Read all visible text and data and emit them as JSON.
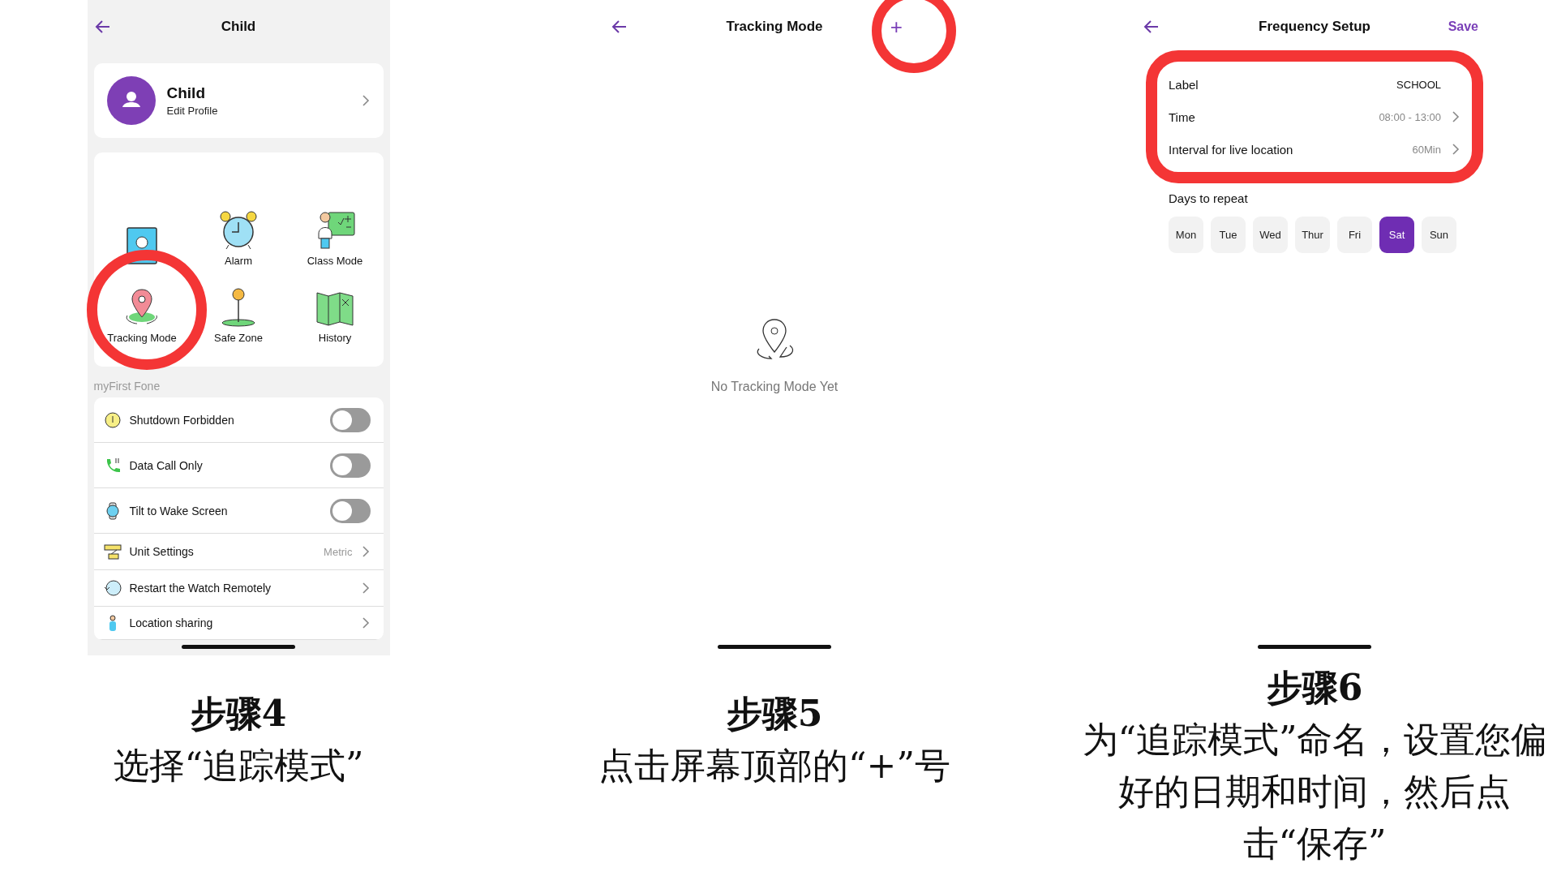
{
  "screens": [
    {
      "kind": "child",
      "title": "Child",
      "profile": {
        "name": "Child",
        "subtitle": "Edit Profile"
      },
      "features": [
        {
          "kind": "contacts"
        },
        {
          "kind": "alarm",
          "label": "Alarm"
        },
        {
          "kind": "class",
          "label": "Class Mode"
        },
        {
          "kind": "tracking",
          "label": "Tracking Mode"
        },
        {
          "kind": "safezone",
          "label": "Safe Zone"
        },
        {
          "kind": "history",
          "label": "History"
        }
      ],
      "section": "myFirst Fone",
      "settings": [
        {
          "kind": "toggle",
          "label": "Shutdown Forbidden",
          "on": false
        },
        {
          "kind": "toggle",
          "label": "Data Call Only",
          "on": false
        },
        {
          "kind": "toggle",
          "label": "Tilt to Wake Screen",
          "on": false
        },
        {
          "kind": "link",
          "label": "Unit Settings",
          "value": "Metric"
        },
        {
          "kind": "link",
          "label": "Restart the Watch Remotely"
        },
        {
          "kind": "link",
          "label": "Location sharing"
        }
      ]
    },
    {
      "kind": "tracking",
      "title": "Tracking Mode",
      "action": "+",
      "empty": "No Tracking Mode Yet"
    },
    {
      "kind": "frequency",
      "title": "Frequency Setup",
      "save": "Save",
      "fields": [
        {
          "kind": "text",
          "label": "Label",
          "value": "SCHOOL"
        },
        {
          "kind": "picker",
          "label": "Time",
          "value": "08:00 - 13:00"
        },
        {
          "kind": "picker",
          "label": "Interval for live location",
          "value": "60Min"
        }
      ],
      "days_label": "Days to repeat",
      "days": [
        {
          "label": "Mon",
          "selected": false
        },
        {
          "label": "Tue",
          "selected": false
        },
        {
          "label": "Wed",
          "selected": false
        },
        {
          "label": "Thur",
          "selected": false
        },
        {
          "label": "Fri",
          "selected": false
        },
        {
          "label": "Sat",
          "selected": true
        },
        {
          "label": "Sun",
          "selected": false
        }
      ]
    }
  ],
  "steps": [
    {
      "title": "步骤4",
      "description": "选择“追踪模式”"
    },
    {
      "title": "步骤5",
      "description": "点击屏幕顶部的“+”号"
    },
    {
      "title": "步骤6",
      "description": "为“追踪模式”命名，设置您偏好的日期和时间，然后点击“保存”"
    }
  ]
}
